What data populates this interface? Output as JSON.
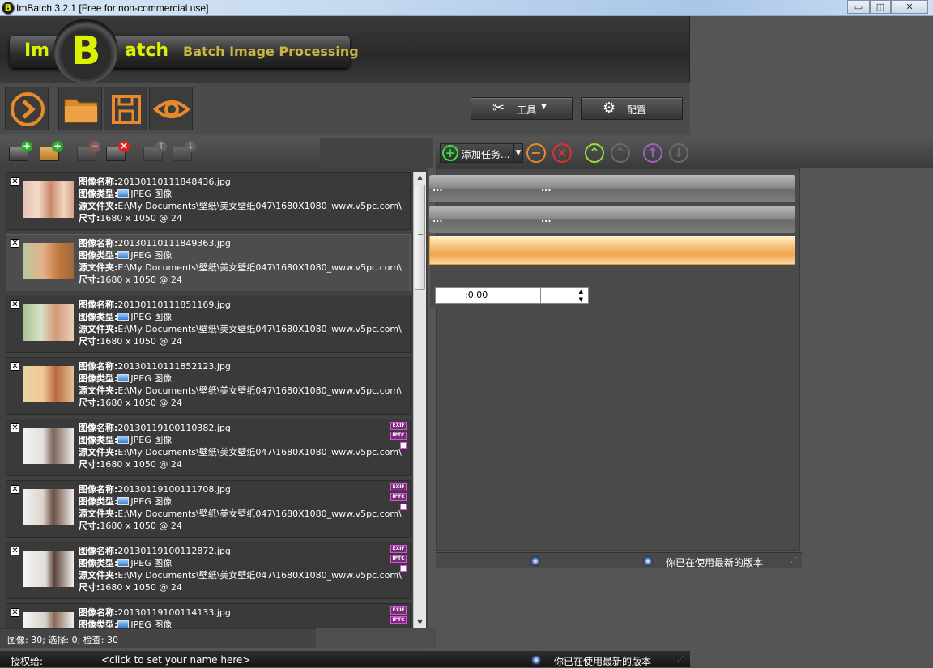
{
  "window": {
    "title": "ImBatch 3.2.1 [Free for non-commercial use]",
    "app_icon_letter": "B",
    "minimize": "▭",
    "restore": "◫",
    "close": "✕"
  },
  "logo": {
    "im": "Im",
    "b": "B",
    "atch": "atch",
    "tagline": "Batch Image Processing"
  },
  "header_buttons": {
    "tools_label": "工具",
    "config_label": "配置"
  },
  "task_toolbar": {
    "add_task_label": "添加任务..."
  },
  "tasks": {
    "row1_text": "...",
    "row2_text": "...",
    "spin_value": ":0.00"
  },
  "labels": {
    "name": "图像名称:",
    "type": "图像类型:",
    "folder": "源文件夹:",
    "size": "尺寸:"
  },
  "images": [
    {
      "name": "20130110111848436.jpg",
      "type": "JPEG 图像",
      "folder": "E:\\My Documents\\壁纸\\美女壁纸047\\1680X1080_www.v5pc.com\\",
      "dims": "1680 x 1050 @ 24",
      "exif": false,
      "iptc": false
    },
    {
      "name": "20130110111849363.jpg",
      "type": "JPEG 图像",
      "folder": "E:\\My Documents\\壁纸\\美女壁纸047\\1680X1080_www.v5pc.com\\",
      "dims": "1680 x 1050 @ 24",
      "exif": false,
      "iptc": false
    },
    {
      "name": "20130110111851169.jpg",
      "type": "JPEG 图像",
      "folder": "E:\\My Documents\\壁纸\\美女壁纸047\\1680X1080_www.v5pc.com\\",
      "dims": "1680 x 1050 @ 24",
      "exif": false,
      "iptc": false
    },
    {
      "name": "20130110111852123.jpg",
      "type": "JPEG 图像",
      "folder": "E:\\My Documents\\壁纸\\美女壁纸047\\1680X1080_www.v5pc.com\\",
      "dims": "1680 x 1050 @ 24",
      "exif": false,
      "iptc": false
    },
    {
      "name": "20130119100110382.jpg",
      "type": "JPEG 图像",
      "folder": "E:\\My Documents\\壁纸\\美女壁纸047\\1680X1080_www.v5pc.com\\",
      "dims": "1680 x 1050 @ 24",
      "exif": true,
      "iptc": true
    },
    {
      "name": "20130119100111708.jpg",
      "type": "JPEG 图像",
      "folder": "E:\\My Documents\\壁纸\\美女壁纸047\\1680X1080_www.v5pc.com\\",
      "dims": "1680 x 1050 @ 24",
      "exif": true,
      "iptc": true
    },
    {
      "name": "20130119100112872.jpg",
      "type": "JPEG 图像",
      "folder": "E:\\My Documents\\壁纸\\美女壁纸047\\1680X1080_www.v5pc.com\\",
      "dims": "1680 x 1050 @ 24",
      "exif": true,
      "iptc": true
    },
    {
      "name": "20130119100114133.jpg",
      "type": "JPEG 图像",
      "folder": "",
      "dims": "",
      "exif": true,
      "iptc": true
    }
  ],
  "badges": {
    "exif": "EXIF",
    "iptc": "IPTC"
  },
  "status": {
    "counts": "图像: 30; 选择: 0; 检查: 30",
    "right_status": "你已在使用最新的版本"
  },
  "bottom": {
    "licensed_to": "授权给:",
    "name_prompt": "<click to set your name here>",
    "version_status": "你已在使用最新的版本"
  },
  "icons": {
    "next": "arrow-right-circle",
    "open": "folder",
    "save": "floppy-disk",
    "preview": "eye",
    "tools": "wrench-screwdriver",
    "config": "gear"
  },
  "colors": {
    "accent_yellow": "#ddf000",
    "task_selected": "#f1a552",
    "panel_dark": "#3a3a3a"
  }
}
